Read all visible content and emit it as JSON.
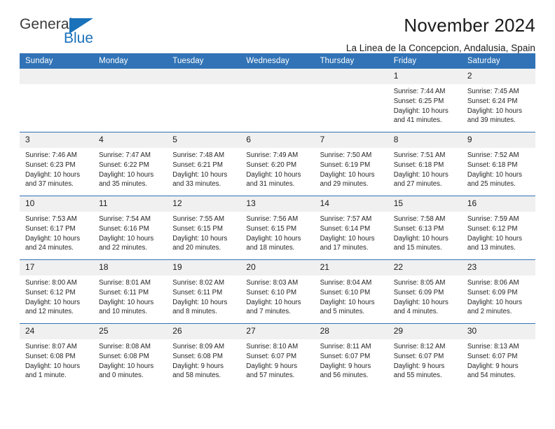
{
  "brand": {
    "name_top": "General",
    "name_bottom": "Blue",
    "triangle_color": "#1a72bb",
    "text_color": "#3a3a3a"
  },
  "header": {
    "title": "November 2024",
    "subtitle": "La Linea de la Concepcion, Andalusia, Spain"
  },
  "colors": {
    "header_blue": "#3173b6",
    "daynum_band": "#f0f0f0",
    "row_divider": "#3173b6",
    "text": "#1b1b1b"
  },
  "calendar": {
    "weekday_headers": [
      "Sunday",
      "Monday",
      "Tuesday",
      "Wednesday",
      "Thursday",
      "Friday",
      "Saturday"
    ],
    "weeks": [
      [
        {
          "day": "",
          "empty": true,
          "lines": []
        },
        {
          "day": "",
          "empty": true,
          "lines": []
        },
        {
          "day": "",
          "empty": true,
          "lines": []
        },
        {
          "day": "",
          "empty": true,
          "lines": []
        },
        {
          "day": "",
          "empty": true,
          "lines": []
        },
        {
          "day": "1",
          "empty": false,
          "lines": [
            "Sunrise: 7:44 AM",
            "Sunset: 6:25 PM",
            "Daylight: 10 hours",
            "and 41 minutes."
          ]
        },
        {
          "day": "2",
          "empty": false,
          "lines": [
            "Sunrise: 7:45 AM",
            "Sunset: 6:24 PM",
            "Daylight: 10 hours",
            "and 39 minutes."
          ]
        }
      ],
      [
        {
          "day": "3",
          "empty": false,
          "lines": [
            "Sunrise: 7:46 AM",
            "Sunset: 6:23 PM",
            "Daylight: 10 hours",
            "and 37 minutes."
          ]
        },
        {
          "day": "4",
          "empty": false,
          "lines": [
            "Sunrise: 7:47 AM",
            "Sunset: 6:22 PM",
            "Daylight: 10 hours",
            "and 35 minutes."
          ]
        },
        {
          "day": "5",
          "empty": false,
          "lines": [
            "Sunrise: 7:48 AM",
            "Sunset: 6:21 PM",
            "Daylight: 10 hours",
            "and 33 minutes."
          ]
        },
        {
          "day": "6",
          "empty": false,
          "lines": [
            "Sunrise: 7:49 AM",
            "Sunset: 6:20 PM",
            "Daylight: 10 hours",
            "and 31 minutes."
          ]
        },
        {
          "day": "7",
          "empty": false,
          "lines": [
            "Sunrise: 7:50 AM",
            "Sunset: 6:19 PM",
            "Daylight: 10 hours",
            "and 29 minutes."
          ]
        },
        {
          "day": "8",
          "empty": false,
          "lines": [
            "Sunrise: 7:51 AM",
            "Sunset: 6:18 PM",
            "Daylight: 10 hours",
            "and 27 minutes."
          ]
        },
        {
          "day": "9",
          "empty": false,
          "lines": [
            "Sunrise: 7:52 AM",
            "Sunset: 6:18 PM",
            "Daylight: 10 hours",
            "and 25 minutes."
          ]
        }
      ],
      [
        {
          "day": "10",
          "empty": false,
          "lines": [
            "Sunrise: 7:53 AM",
            "Sunset: 6:17 PM",
            "Daylight: 10 hours",
            "and 24 minutes."
          ]
        },
        {
          "day": "11",
          "empty": false,
          "lines": [
            "Sunrise: 7:54 AM",
            "Sunset: 6:16 PM",
            "Daylight: 10 hours",
            "and 22 minutes."
          ]
        },
        {
          "day": "12",
          "empty": false,
          "lines": [
            "Sunrise: 7:55 AM",
            "Sunset: 6:15 PM",
            "Daylight: 10 hours",
            "and 20 minutes."
          ]
        },
        {
          "day": "13",
          "empty": false,
          "lines": [
            "Sunrise: 7:56 AM",
            "Sunset: 6:15 PM",
            "Daylight: 10 hours",
            "and 18 minutes."
          ]
        },
        {
          "day": "14",
          "empty": false,
          "lines": [
            "Sunrise: 7:57 AM",
            "Sunset: 6:14 PM",
            "Daylight: 10 hours",
            "and 17 minutes."
          ]
        },
        {
          "day": "15",
          "empty": false,
          "lines": [
            "Sunrise: 7:58 AM",
            "Sunset: 6:13 PM",
            "Daylight: 10 hours",
            "and 15 minutes."
          ]
        },
        {
          "day": "16",
          "empty": false,
          "lines": [
            "Sunrise: 7:59 AM",
            "Sunset: 6:12 PM",
            "Daylight: 10 hours",
            "and 13 minutes."
          ]
        }
      ],
      [
        {
          "day": "17",
          "empty": false,
          "lines": [
            "Sunrise: 8:00 AM",
            "Sunset: 6:12 PM",
            "Daylight: 10 hours",
            "and 12 minutes."
          ]
        },
        {
          "day": "18",
          "empty": false,
          "lines": [
            "Sunrise: 8:01 AM",
            "Sunset: 6:11 PM",
            "Daylight: 10 hours",
            "and 10 minutes."
          ]
        },
        {
          "day": "19",
          "empty": false,
          "lines": [
            "Sunrise: 8:02 AM",
            "Sunset: 6:11 PM",
            "Daylight: 10 hours",
            "and 8 minutes."
          ]
        },
        {
          "day": "20",
          "empty": false,
          "lines": [
            "Sunrise: 8:03 AM",
            "Sunset: 6:10 PM",
            "Daylight: 10 hours",
            "and 7 minutes."
          ]
        },
        {
          "day": "21",
          "empty": false,
          "lines": [
            "Sunrise: 8:04 AM",
            "Sunset: 6:10 PM",
            "Daylight: 10 hours",
            "and 5 minutes."
          ]
        },
        {
          "day": "22",
          "empty": false,
          "lines": [
            "Sunrise: 8:05 AM",
            "Sunset: 6:09 PM",
            "Daylight: 10 hours",
            "and 4 minutes."
          ]
        },
        {
          "day": "23",
          "empty": false,
          "lines": [
            "Sunrise: 8:06 AM",
            "Sunset: 6:09 PM",
            "Daylight: 10 hours",
            "and 2 minutes."
          ]
        }
      ],
      [
        {
          "day": "24",
          "empty": false,
          "lines": [
            "Sunrise: 8:07 AM",
            "Sunset: 6:08 PM",
            "Daylight: 10 hours",
            "and 1 minute."
          ]
        },
        {
          "day": "25",
          "empty": false,
          "lines": [
            "Sunrise: 8:08 AM",
            "Sunset: 6:08 PM",
            "Daylight: 10 hours",
            "and 0 minutes."
          ]
        },
        {
          "day": "26",
          "empty": false,
          "lines": [
            "Sunrise: 8:09 AM",
            "Sunset: 6:08 PM",
            "Daylight: 9 hours",
            "and 58 minutes."
          ]
        },
        {
          "day": "27",
          "empty": false,
          "lines": [
            "Sunrise: 8:10 AM",
            "Sunset: 6:07 PM",
            "Daylight: 9 hours",
            "and 57 minutes."
          ]
        },
        {
          "day": "28",
          "empty": false,
          "lines": [
            "Sunrise: 8:11 AM",
            "Sunset: 6:07 PM",
            "Daylight: 9 hours",
            "and 56 minutes."
          ]
        },
        {
          "day": "29",
          "empty": false,
          "lines": [
            "Sunrise: 8:12 AM",
            "Sunset: 6:07 PM",
            "Daylight: 9 hours",
            "and 55 minutes."
          ]
        },
        {
          "day": "30",
          "empty": false,
          "lines": [
            "Sunrise: 8:13 AM",
            "Sunset: 6:07 PM",
            "Daylight: 9 hours",
            "and 54 minutes."
          ]
        }
      ]
    ]
  }
}
